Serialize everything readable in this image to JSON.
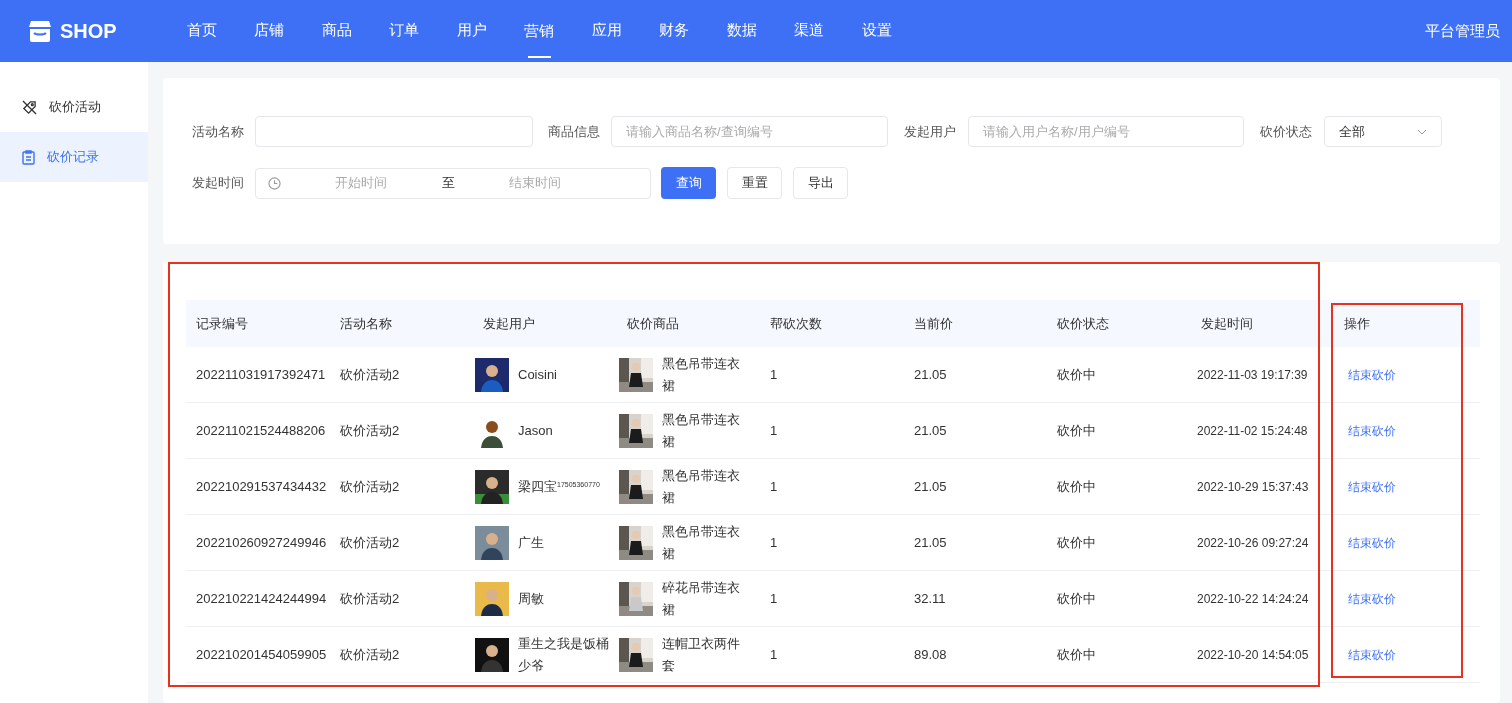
{
  "header": {
    "logo": "SHOP",
    "nav": [
      {
        "label": "首页",
        "selected": false
      },
      {
        "label": "店铺",
        "selected": false
      },
      {
        "label": "商品",
        "selected": false
      },
      {
        "label": "订单",
        "selected": false
      },
      {
        "label": "用户",
        "selected": false
      },
      {
        "label": "营销",
        "selected": true
      },
      {
        "label": "应用",
        "selected": false
      },
      {
        "label": "财务",
        "selected": false
      },
      {
        "label": "数据",
        "selected": false
      },
      {
        "label": "渠道",
        "selected": false
      },
      {
        "label": "设置",
        "selected": false
      }
    ],
    "user": "平台管理员"
  },
  "sidebar": {
    "items": [
      {
        "label": "砍价活动",
        "selected": false
      },
      {
        "label": "砍价记录",
        "selected": true
      }
    ]
  },
  "filters": {
    "activity_name": {
      "label": "活动名称"
    },
    "product_info": {
      "label": "商品信息",
      "placeholder": "请输入商品名称/查询编号"
    },
    "initiator": {
      "label": "发起用户",
      "placeholder": "请输入用户名称/用户编号"
    },
    "status": {
      "label": "砍价状态",
      "value": "全部"
    },
    "time": {
      "label": "发起时间",
      "start_placeholder": "开始时间",
      "separator": "至",
      "end_placeholder": "结束时间"
    },
    "buttons": [
      {
        "label": "查询",
        "kind": "primary"
      },
      {
        "label": "重置",
        "kind": "default"
      },
      {
        "label": "导出",
        "kind": "default"
      }
    ]
  },
  "table": {
    "columns": [
      "记录编号",
      "活动名称",
      "发起用户",
      "砍价商品",
      "帮砍次数",
      "当前价",
      "砍价状态",
      "发起时间",
      "操作"
    ],
    "rows": [
      {
        "record_no": "202211031917392471",
        "activity": "砍价活动2",
        "user": "Coisini",
        "product": "黑色吊带连衣裙",
        "help_count": "1",
        "price": "21.05",
        "status": "砍价中",
        "time": "2022-11-03 19:17:39",
        "action": "结束砍价"
      },
      {
        "record_no": "202211021524488206",
        "activity": "砍价活动2",
        "user": "Jason",
        "product": "黑色吊带连衣裙",
        "help_count": "1",
        "price": "21.05",
        "status": "砍价中",
        "time": "2022-11-02 15:24:48",
        "action": "结束砍价"
      },
      {
        "record_no": "202210291537434432",
        "activity": "砍价活动2",
        "user": "梁四宝$^{17505360770}$",
        "product": "黑色吊带连衣裙",
        "help_count": "1",
        "price": "21.05",
        "status": "砍价中",
        "time": "2022-10-29 15:37:43",
        "action": "结束砍价"
      },
      {
        "record_no": "202210260927249946",
        "activity": "砍价活动2",
        "user": "广生",
        "product": "黑色吊带连衣裙",
        "help_count": "1",
        "price": "21.05",
        "status": "砍价中",
        "time": "2022-10-26 09:27:24",
        "action": "结束砍价"
      },
      {
        "record_no": "202210221424244994",
        "activity": "砍价活动2",
        "user": "周敏",
        "product": "碎花吊带连衣裙",
        "help_count": "1",
        "price": "32.11",
        "status": "砍价中",
        "time": "2022-10-22 14:24:24",
        "action": "结束砍价"
      },
      {
        "record_no": "202210201454059905",
        "activity": "砍价活动2",
        "user": "重生之我是饭桶少爷",
        "product": "连帽卫衣两件套",
        "help_count": "1",
        "price": "89.08",
        "status": "砍价中",
        "time": "2022-10-20 14:54:05",
        "action": "结束砍价"
      }
    ]
  }
}
